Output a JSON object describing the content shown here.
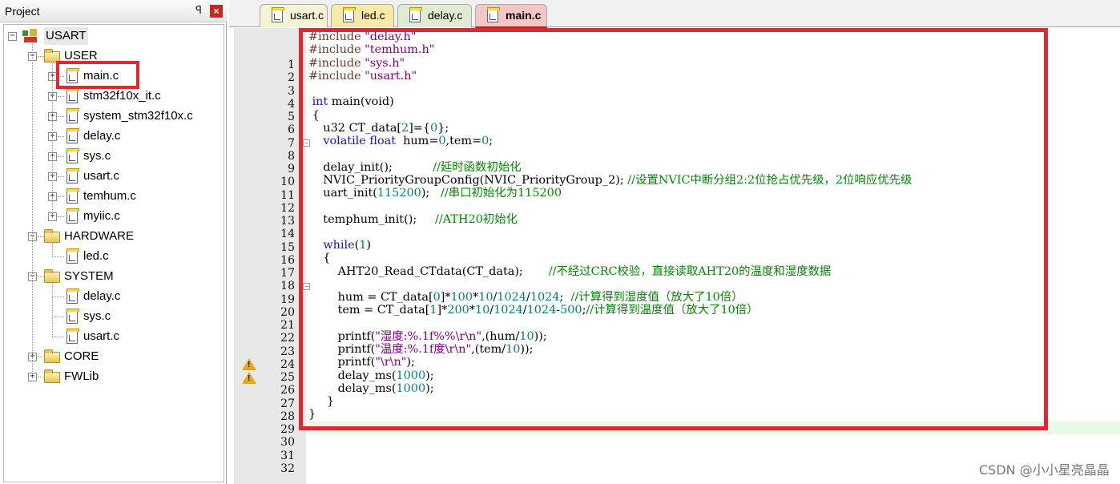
{
  "project": {
    "title": "Project",
    "pin_glyph": "ᵖ",
    "close_glyph": "×",
    "tree": {
      "root": "USART",
      "groups": [
        {
          "name": "USER",
          "expand": "⊟",
          "files": [
            "main.c",
            "stm32f10x_it.c",
            "system_stm32f10x.c",
            "delay.c",
            "sys.c",
            "usart.c",
            "temhum.c",
            "myiic.c"
          ]
        },
        {
          "name": "HARDWARE",
          "expand": "⊟",
          "files": [
            "led.c"
          ]
        },
        {
          "name": "SYSTEM",
          "expand": "⊟",
          "files": [
            "delay.c",
            "sys.c",
            "usart.c"
          ]
        },
        {
          "name": "CORE",
          "expand": "⊞",
          "files": []
        },
        {
          "name": "FWLib",
          "expand": "⊞",
          "files": []
        }
      ]
    }
  },
  "tabs": [
    {
      "label": "usart.c",
      "active": false,
      "color": "#f6f3d4"
    },
    {
      "label": "led.c",
      "active": false,
      "color": "#f8e9a6"
    },
    {
      "label": "delay.c",
      "active": false,
      "color": "#e0ebd2"
    },
    {
      "label": "main.c",
      "active": true,
      "color": "#f4c6c6"
    }
  ],
  "editor": {
    "line_numbers": [
      "1",
      "2",
      "3",
      "4",
      "5",
      "6",
      "7",
      "8",
      "9",
      "10",
      "11",
      "12",
      "13",
      "14",
      "15",
      "16",
      "17",
      "18",
      "19",
      "20",
      "21",
      "22",
      "23",
      "24",
      "25",
      "26",
      "27",
      "28",
      "29",
      "30",
      "31",
      "32"
    ],
    "code": [
      [
        [
          "p",
          "#include "
        ],
        [
          "s",
          "\"delay.h\""
        ]
      ],
      [
        [
          "p",
          "#include "
        ],
        [
          "s",
          "\"temhum.h\""
        ]
      ],
      [
        [
          "p",
          "#include "
        ],
        [
          "s",
          "\"sys.h\""
        ]
      ],
      [
        [
          "p",
          "#include "
        ],
        [
          "s",
          "\"usart.h\""
        ]
      ],
      [],
      [
        [
          "t",
          " "
        ],
        [
          "k",
          "int"
        ],
        [
          "t",
          " main(void)"
        ]
      ],
      [
        [
          "t",
          " {"
        ]
      ],
      [
        [
          "t",
          "    u32 CT_data["
        ],
        [
          "n",
          "2"
        ],
        [
          "t",
          "]={"
        ],
        [
          "n",
          "0"
        ],
        [
          "t",
          "};"
        ]
      ],
      [
        [
          "t",
          "    "
        ],
        [
          "k",
          "volatile"
        ],
        [
          "t",
          " "
        ],
        [
          "k",
          "float"
        ],
        [
          "t",
          "  hum="
        ],
        [
          "n",
          "0"
        ],
        [
          "t",
          ",tem="
        ],
        [
          "n",
          "0"
        ],
        [
          "t",
          ";"
        ]
      ],
      [],
      [
        [
          "t",
          "    delay_init();           "
        ],
        [
          "c",
          "//延时函数初始化"
        ]
      ],
      [
        [
          "t",
          "    NVIC_PriorityGroupConfig(NVIC_PriorityGroup_2); "
        ],
        [
          "c",
          "//设置NVIC中断分组2:2位抢占优先级，2位响应优先级"
        ]
      ],
      [
        [
          "t",
          "    uart_init("
        ],
        [
          "n",
          "115200"
        ],
        [
          "t",
          ");   "
        ],
        [
          "c",
          "//串口初始化为115200"
        ]
      ],
      [],
      [
        [
          "t",
          "    temphum_init();     "
        ],
        [
          "c",
          "//ATH20初始化"
        ]
      ],
      [],
      [
        [
          "t",
          "    "
        ],
        [
          "k",
          "while"
        ],
        [
          "t",
          "("
        ],
        [
          "n",
          "1"
        ],
        [
          "t",
          ")"
        ]
      ],
      [
        [
          "t",
          "    {"
        ]
      ],
      [
        [
          "t",
          "        AHT20_Read_CTdata(CT_data);       "
        ],
        [
          "c",
          "//不经过CRC校验，直接读取AHT20的温度和湿度数据"
        ]
      ],
      [],
      [
        [
          "t",
          "        hum = CT_data["
        ],
        [
          "n",
          "0"
        ],
        [
          "t",
          "]*"
        ],
        [
          "n",
          "100"
        ],
        [
          "t",
          "*"
        ],
        [
          "n",
          "10"
        ],
        [
          "t",
          "/"
        ],
        [
          "n",
          "1024"
        ],
        [
          "t",
          "/"
        ],
        [
          "n",
          "1024"
        ],
        [
          "t",
          ";  "
        ],
        [
          "c",
          "//计算得到湿度值（放大了10倍）"
        ]
      ],
      [
        [
          "t",
          "        tem = CT_data["
        ],
        [
          "n",
          "1"
        ],
        [
          "t",
          "]*"
        ],
        [
          "n",
          "200"
        ],
        [
          "t",
          "*"
        ],
        [
          "n",
          "10"
        ],
        [
          "t",
          "/"
        ],
        [
          "n",
          "1024"
        ],
        [
          "t",
          "/"
        ],
        [
          "n",
          "1024"
        ],
        [
          "t",
          "-"
        ],
        [
          "n",
          "500"
        ],
        [
          "t",
          ";"
        ],
        [
          "c",
          "//计算得到温度值（放大了10倍）"
        ]
      ],
      [],
      [
        [
          "t",
          "        printf("
        ],
        [
          "s",
          "\"湿度:%.1f%%\\r\\n\""
        ],
        [
          "t",
          ",(hum/"
        ],
        [
          "n",
          "10"
        ],
        [
          "t",
          "));"
        ]
      ],
      [
        [
          "t",
          "        printf("
        ],
        [
          "s",
          "\"温度:%.1f度\\r\\n\""
        ],
        [
          "t",
          ",(tem/"
        ],
        [
          "n",
          "10"
        ],
        [
          "t",
          "));"
        ]
      ],
      [
        [
          "t",
          "        printf("
        ],
        [
          "s",
          "\"\\r\\n\""
        ],
        [
          "t",
          ");"
        ]
      ],
      [
        [
          "t",
          "        delay_ms("
        ],
        [
          "n",
          "1000"
        ],
        [
          "t",
          ");"
        ]
      ],
      [
        [
          "t",
          "        delay_ms("
        ],
        [
          "n",
          "1000"
        ],
        [
          "t",
          ");"
        ]
      ],
      [
        [
          "t",
          "     }"
        ]
      ],
      [
        [
          "t",
          "}"
        ]
      ],
      [],
      []
    ],
    "highlight_line": 31,
    "fold_lines": [
      7,
      18
    ],
    "warning_lines": [
      24,
      25
    ]
  },
  "watermark": "CSDN @小小星亮晶晶"
}
